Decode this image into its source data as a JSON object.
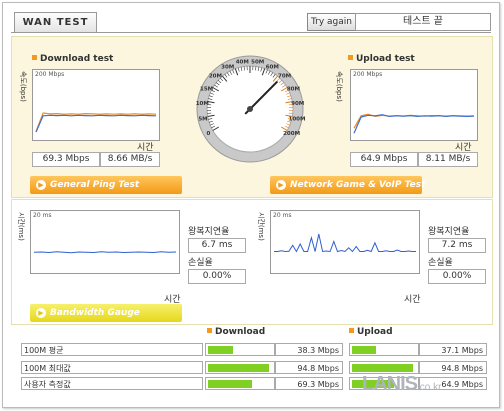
{
  "header": {
    "tab_label": "WAN TEST",
    "try_again_label": "Try again",
    "status_text": "테스트 끝"
  },
  "download": {
    "title": "Download test",
    "ylabel": "속도(bps)",
    "scale": "200 Mbps",
    "xlabel": "시간",
    "speed": "69.3 Mbps",
    "rate": "8.66 MB/s",
    "chart_data": {
      "type": "line",
      "ylim": [
        0,
        200
      ],
      "series": [
        {
          "color": "#f08a1c",
          "values": [
            16,
            82,
            79,
            80,
            78,
            79,
            78,
            80,
            79,
            78,
            79,
            78,
            79,
            78,
            79,
            78,
            79,
            78
          ]
        },
        {
          "color": "#3b6fd0",
          "values": [
            14,
            72,
            74,
            73,
            74,
            72,
            74,
            73,
            72,
            74,
            73,
            72,
            74,
            73,
            72,
            74,
            73,
            72
          ]
        }
      ]
    }
  },
  "upload": {
    "title": "Upload test",
    "ylabel": "속도(bps)",
    "scale": "200 Mbps",
    "xlabel": "시간",
    "speed": "64.9 Mbps",
    "rate": "8.11 MB/s",
    "chart_data": {
      "type": "line",
      "ylim": [
        0,
        200
      ],
      "series": [
        {
          "color": "#f08a1c",
          "values": [
            28,
            72,
            78,
            70,
            74,
            71,
            73,
            71,
            74,
            72,
            71,
            73,
            72,
            71,
            73,
            72,
            71,
            72
          ]
        },
        {
          "color": "#3b6fd0",
          "values": [
            10,
            68,
            74,
            72,
            76,
            70,
            72,
            71,
            73,
            70,
            72,
            71,
            73,
            70,
            72,
            71,
            70,
            71
          ]
        }
      ]
    }
  },
  "gauge": {
    "ticks": [
      "0",
      "5M",
      "10M",
      "15M",
      "20M",
      "30M",
      "40M",
      "50M",
      "60M",
      "70M",
      "80M",
      "90M",
      "100M",
      "200M"
    ],
    "value_mbps": 69.3
  },
  "ping": {
    "button_label": "General Ping Test",
    "ylabel": "시간(ms)",
    "scale": "20 ms",
    "xlabel": "시간",
    "rtt_label": "왕복지연율",
    "rtt_value": "6.7 ms",
    "loss_label": "손실율",
    "loss_value": "0.00%",
    "chart_data": {
      "type": "line",
      "ylim": [
        0,
        20
      ],
      "values": [
        6.7,
        6.8,
        6.6,
        6.9,
        6.7,
        6.5,
        6.8,
        6.7,
        6.6,
        6.9,
        6.7,
        6.8,
        6.6,
        6.7,
        6.8,
        6.7,
        6.6,
        6.9,
        6.7,
        6.8
      ]
    }
  },
  "game": {
    "button_label": "Network Game & VoIP Test",
    "ylabel": "시간(ms)",
    "scale": "20 ms",
    "xlabel": "시간",
    "rtt_label": "왕복지연율",
    "rtt_value": "7.2 ms",
    "loss_label": "손실율",
    "loss_value": "0.00%",
    "chart_data": {
      "type": "line",
      "ylim": [
        0,
        20
      ],
      "values": [
        7,
        7,
        7.3,
        7,
        7.1,
        9.5,
        7,
        10,
        7,
        7,
        12.5,
        7,
        14,
        7,
        7.2,
        7,
        11,
        7,
        7.4,
        7,
        8.5,
        7,
        9,
        7,
        7,
        7.5,
        7,
        10.5,
        7,
        7,
        7.3,
        7,
        7,
        7.6,
        7,
        7,
        7.2,
        7,
        7
      ]
    }
  },
  "bandwidth": {
    "button_label": "Bandwidth Gauge",
    "download_label": "Download",
    "upload_label": "Upload",
    "rows": [
      {
        "label": "100M 평균",
        "down_value": "38.3 Mbps",
        "down_pct": 38.3,
        "up_value": "37.1 Mbps",
        "up_pct": 37.1
      },
      {
        "label": "100M 최대값",
        "down_value": "94.8 Mbps",
        "down_pct": 94.8,
        "up_value": "94.8 Mbps",
        "up_pct": 94.8
      },
      {
        "label": "사용자 측정값",
        "down_value": "69.3 Mbps",
        "down_pct": 69.3,
        "up_value": "64.9 Mbps",
        "up_pct": 64.9
      }
    ]
  },
  "logo": {
    "main": "LANIS",
    "suffix": ".co.kr"
  }
}
